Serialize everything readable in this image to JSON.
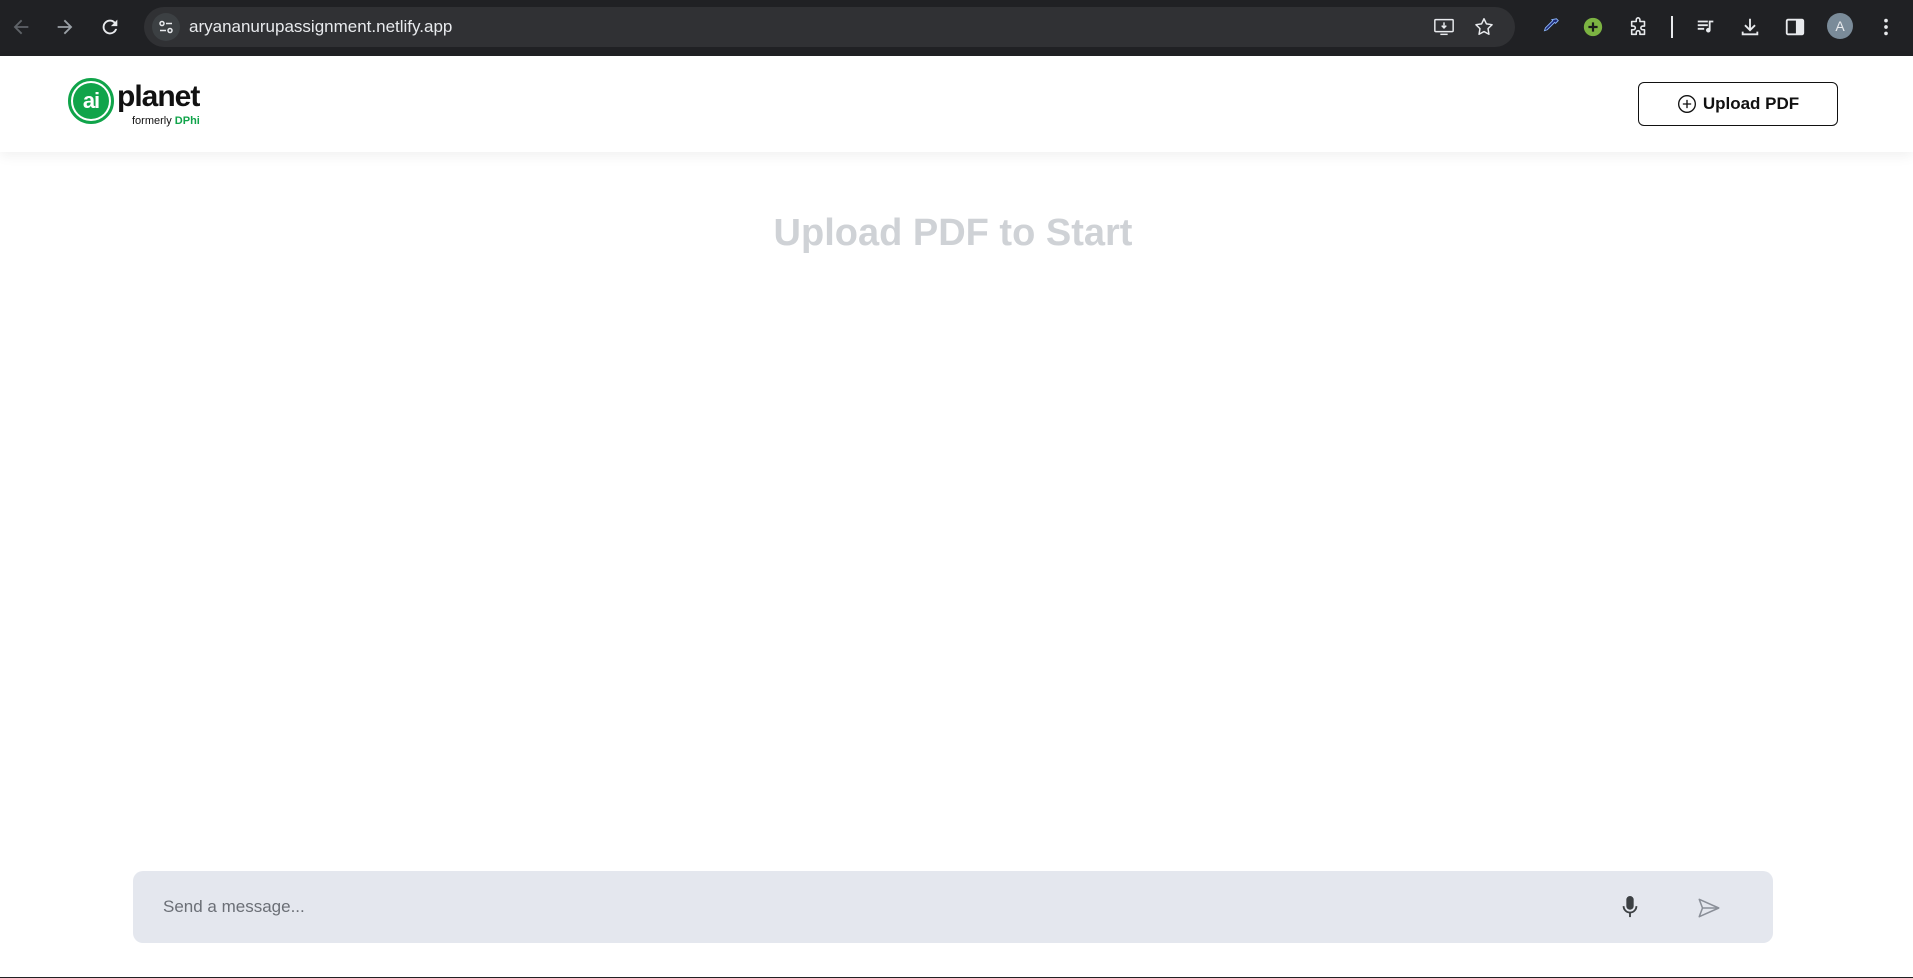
{
  "browser": {
    "url": "aryananurupassignment.netlify.app",
    "profile_initial": "A",
    "icons": [
      "back-icon",
      "forward-icon",
      "reload-icon",
      "site-info-icon",
      "install-app-icon",
      "bookmark-star-icon",
      "eyedropper-icon",
      "extension-plus-icon",
      "extensions-puzzle-icon",
      "media-queue-icon",
      "download-icon",
      "side-panel-icon",
      "kebab-menu-icon"
    ]
  },
  "header": {
    "logo_mark": "ai",
    "logo_word": "planet",
    "logo_sub_prefix": "formerly",
    "logo_sub_brand": "DPhi",
    "upload_button_label": "Upload PDF"
  },
  "main": {
    "empty_state_title": "Upload PDF to Start"
  },
  "composer": {
    "placeholder": "Send a message...",
    "value": ""
  },
  "colors": {
    "brand_green": "#10a44a",
    "chrome_bg": "#202124",
    "composer_bg": "#e4e7ee",
    "empty_title": "#cfd2d6"
  }
}
